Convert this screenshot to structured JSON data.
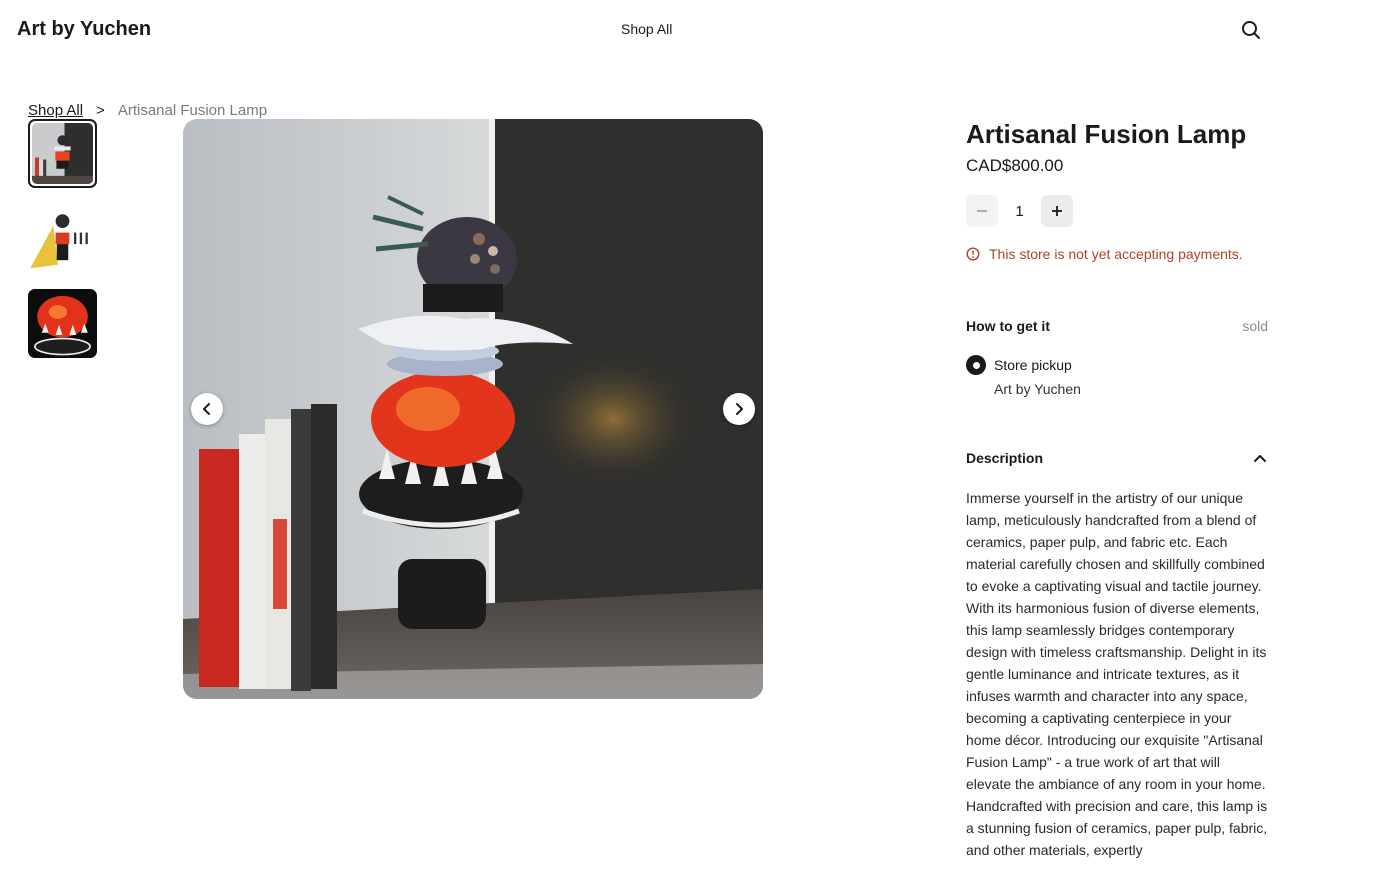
{
  "header": {
    "brand": "Art by Yuchen",
    "nav_shop_all": "Shop All"
  },
  "breadcrumb": {
    "parent": "Shop All",
    "separator": ">",
    "current": "Artisanal Fusion Lamp"
  },
  "gallery": {
    "thumbnails": [
      "lamp-in-corner",
      "lamp-with-sketches",
      "lamp-lit-closeup"
    ],
    "active_index": 0
  },
  "product": {
    "title": "Artisanal Fusion Lamp",
    "price": "CAD$800.00",
    "quantity": "1",
    "notice": "This store is not yet accepting payments.",
    "how_to_get_label": "How to get it",
    "status": "sold",
    "pickup_method": "Store pickup",
    "pickup_location": "Art by Yuchen",
    "description_label": "Description",
    "description": "Immerse yourself in the artistry of our unique lamp, meticulously handcrafted from a blend of ceramics, paper pulp, and fabric etc. Each material carefully chosen and skillfully combined to evoke a captivating visual and tactile journey. With its harmonious fusion of diverse elements, this lamp seamlessly bridges contemporary design with timeless craftsmanship. Delight in its gentle luminance and intricate textures, as it infuses warmth and character into any space, becoming a captivating centerpiece in your home décor. Introducing our exquisite \"Artisanal Fusion Lamp\" - a true work of art that will elevate the ambiance of any room in your home. Handcrafted with precision and care, this lamp is a stunning fusion of ceramics, paper pulp, fabric, and other materials, expertly"
  },
  "colors": {
    "accent": "#1a1a1a",
    "warning": "#b0422a",
    "muted": "#8a8a8a"
  },
  "icons": [
    "search-icon",
    "chevron-left-icon",
    "chevron-right-icon",
    "minus-icon",
    "plus-icon",
    "alert-circle-icon",
    "chevron-up-icon"
  ]
}
